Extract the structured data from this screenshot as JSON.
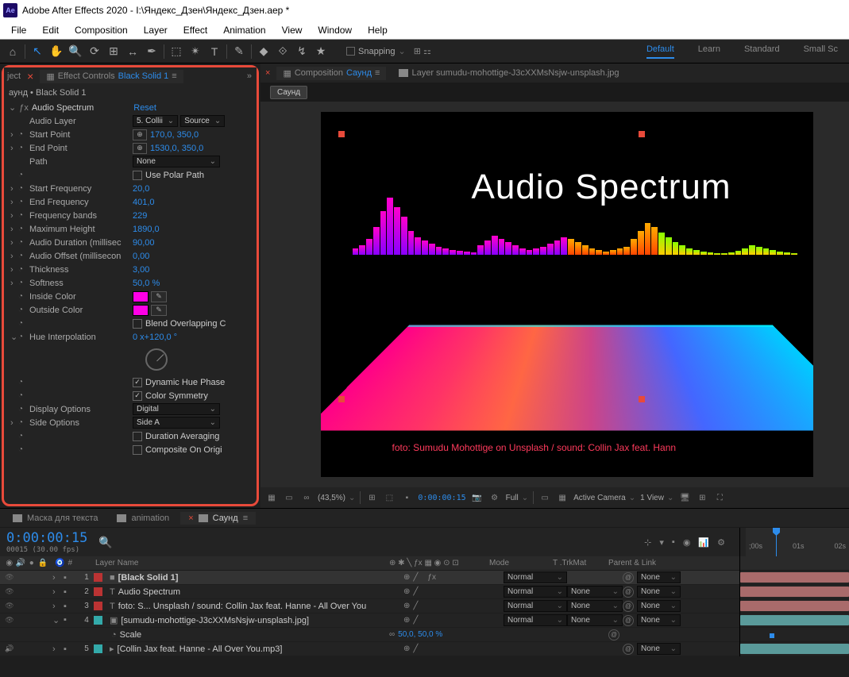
{
  "title": "Adobe After Effects 2020 - I:\\Яндекс_Дзен\\Яндекс_Дзен.aep *",
  "app_badge": "Ae",
  "menu": [
    "File",
    "Edit",
    "Composition",
    "Layer",
    "Effect",
    "Animation",
    "View",
    "Window",
    "Help"
  ],
  "toolbar_icons": [
    "⌂",
    "↖",
    "✋",
    "🔍",
    "⟳",
    "⊞",
    "↔",
    "✒",
    "⬚",
    "✴",
    "T",
    "✎",
    "◆",
    "⟐",
    "↯",
    "★"
  ],
  "snapping_label": "Snapping",
  "workspaces": {
    "items": [
      "Default",
      "Learn",
      "Standard",
      "Small Sc"
    ],
    "active": 0
  },
  "effect_controls": {
    "tab_prefix": "Effect Controls",
    "tab_subject": "Black Solid 1",
    "header": "аунд • Black Solid 1",
    "effect_name": "Audio Spectrum",
    "reset": "Reset",
    "audio_layer_label": "Audio Layer",
    "audio_layer_val": "5. Collii",
    "audio_layer_source": "Source",
    "props": [
      {
        "k": "start_point",
        "label": "Start Point",
        "val": "170,0, 350,0",
        "target": true
      },
      {
        "k": "end_point",
        "label": "End Point",
        "val": "1530,0, 350,0",
        "target": true
      },
      {
        "k": "path",
        "label": "Path",
        "dd": "None"
      },
      {
        "k": "polar",
        "checkbox": false,
        "label": "Use Polar Path"
      },
      {
        "k": "start_freq",
        "label": "Start Frequency",
        "val": "20,0"
      },
      {
        "k": "end_freq",
        "label": "End Frequency",
        "val": "401,0"
      },
      {
        "k": "bands",
        "label": "Frequency bands",
        "val": "229"
      },
      {
        "k": "max_h",
        "label": "Maximum Height",
        "val": "1890,0"
      },
      {
        "k": "dur",
        "label": "Audio Duration (millisec",
        "val": "90,00"
      },
      {
        "k": "off",
        "label": "Audio Offset (millisecon",
        "val": "0,00"
      },
      {
        "k": "thick",
        "label": "Thickness",
        "val": "3,00"
      },
      {
        "k": "soft",
        "label": "Softness",
        "val": "50,0 %"
      },
      {
        "k": "inside",
        "label": "Inside Color",
        "color": "#ff00e6"
      },
      {
        "k": "outside",
        "label": "Outside Color",
        "color": "#ff00e6"
      },
      {
        "k": "blend",
        "checkbox": false,
        "label": "Blend Overlapping C"
      },
      {
        "k": "hue",
        "label": "Hue Interpolation",
        "val": "0 x+120,0 °"
      }
    ],
    "dyn_hue": {
      "label": "Dynamic Hue Phase",
      "checked": true
    },
    "color_sym": {
      "label": "Color Symmetry",
      "checked": true
    },
    "display_opts": {
      "label": "Display Options",
      "val": "Digital"
    },
    "side_opts": {
      "label": "Side Options",
      "val": "Side A"
    },
    "dur_avg": {
      "label": "Duration Averaging",
      "checked": false
    },
    "comp_orig": {
      "label": "Composite On Origi",
      "checked": false
    }
  },
  "composition": {
    "tab_label": "Composition",
    "tab_name": "Саунд",
    "layer_tab": "Layer sumudu-mohottige-J3cXXMsNsjw-unsplash.jpg",
    "flow_tag": "Саунд",
    "viewer_title": "Audio Spectrum",
    "viewer_credit": "foto: Sumudu Mohottige on Unsplash / sound: Collin Jax feat. Hann"
  },
  "viewer_footer": {
    "zoom": "(43,5%)",
    "time": "0:00:00:15",
    "res": "Full",
    "view3d": "Active Camera",
    "views": "1 View"
  },
  "timeline": {
    "tabs": [
      {
        "label": "Маска для текста"
      },
      {
        "label": "animation"
      },
      {
        "label": "Саунд",
        "active": true
      }
    ],
    "timecode": "0:00:00:15",
    "fps": "00015 (30.00 fps)",
    "ruler": [
      ";00s",
      "01s",
      "02s"
    ],
    "cols": {
      "num": "#",
      "layer": "Layer Name",
      "mode": "Mode",
      "trk": "T .TrkMat",
      "pl": "Parent & Link"
    },
    "layers": [
      {
        "n": "1",
        "color": "#b33",
        "name": "[Black Solid 1]",
        "mode": "Normal",
        "trk": "",
        "pl": "None",
        "sel": true,
        "icon": "■",
        "bar": "#a96b6b",
        "vis": true
      },
      {
        "n": "2",
        "color": "#b33",
        "name": "Audio Spectrum",
        "mode": "Normal",
        "trk": "None",
        "pl": "None",
        "icon": "T",
        "bar": "#a96b6b",
        "vis": true
      },
      {
        "n": "3",
        "color": "#b33",
        "name": "foto: S... Unsplash / sound: Collin Jax feat. Hanne - All Over You",
        "mode": "Normal",
        "trk": "None",
        "pl": "None",
        "icon": "T",
        "bar": "#a96b6b",
        "vis": true
      },
      {
        "n": "4",
        "color": "#3aa",
        "name": "[sumudu-mohottige-J3cXXMsNsjw-unsplash.jpg]",
        "mode": "Normal",
        "trk": "None",
        "pl": "None",
        "icon": "▣",
        "bar": "#5a9a9a",
        "vis": true,
        "open": true
      },
      {
        "scale": true,
        "name": "Scale",
        "val": "50,0, 50,0 %"
      },
      {
        "n": "5",
        "color": "#3aa",
        "name": "[Collin Jax feat. Hanne - All Over You.mp3]",
        "mode": "",
        "trk": "",
        "pl": "None",
        "icon": "▸",
        "bar": "#5a9a9a",
        "audio": true
      }
    ]
  }
}
